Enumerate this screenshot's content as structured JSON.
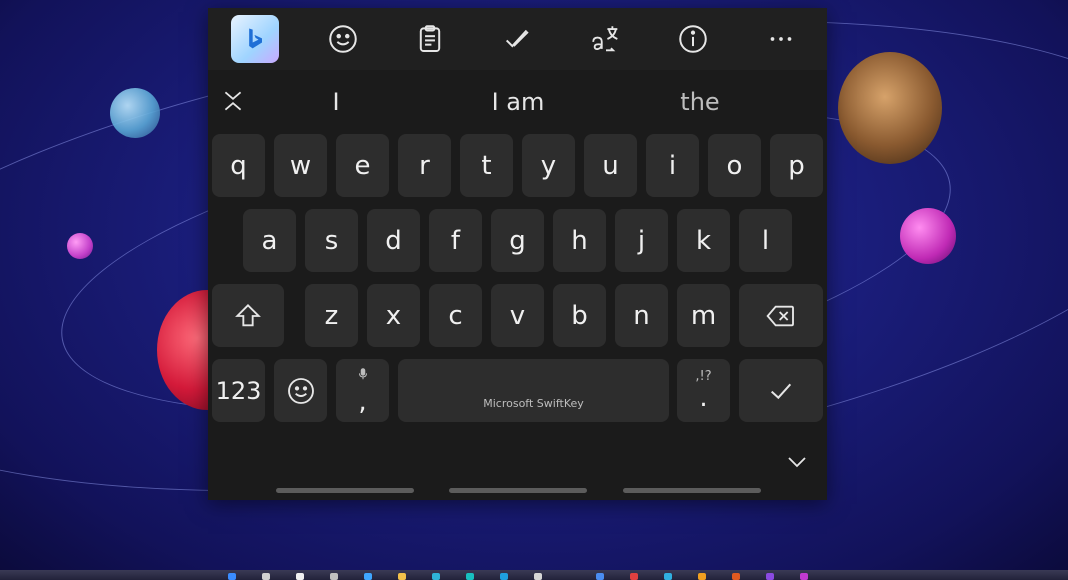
{
  "toolbar": {
    "icons": [
      "bing-icon",
      "emoji-icon",
      "clipboard-icon",
      "checkmark-icon",
      "translate-icon",
      "info-icon",
      "more-icon"
    ]
  },
  "suggestions": [
    "I",
    "I am",
    "the"
  ],
  "keys": {
    "row1": [
      "q",
      "w",
      "e",
      "r",
      "t",
      "y",
      "u",
      "i",
      "o",
      "p"
    ],
    "row2": [
      "a",
      "s",
      "d",
      "f",
      "g",
      "h",
      "j",
      "k",
      "l"
    ],
    "row3": [
      "z",
      "x",
      "c",
      "v",
      "b",
      "n",
      "m"
    ],
    "numbers_label": "123",
    "comma": ",",
    "period": ".",
    "punct_hint": ",!?",
    "space_label": "Microsoft SwiftKey"
  },
  "colors": {
    "keyboard_bg": "#1b1b1b",
    "key_bg": "#2d2d2d",
    "toolbar_bg": "#202020",
    "text": "#f0f0f0"
  }
}
